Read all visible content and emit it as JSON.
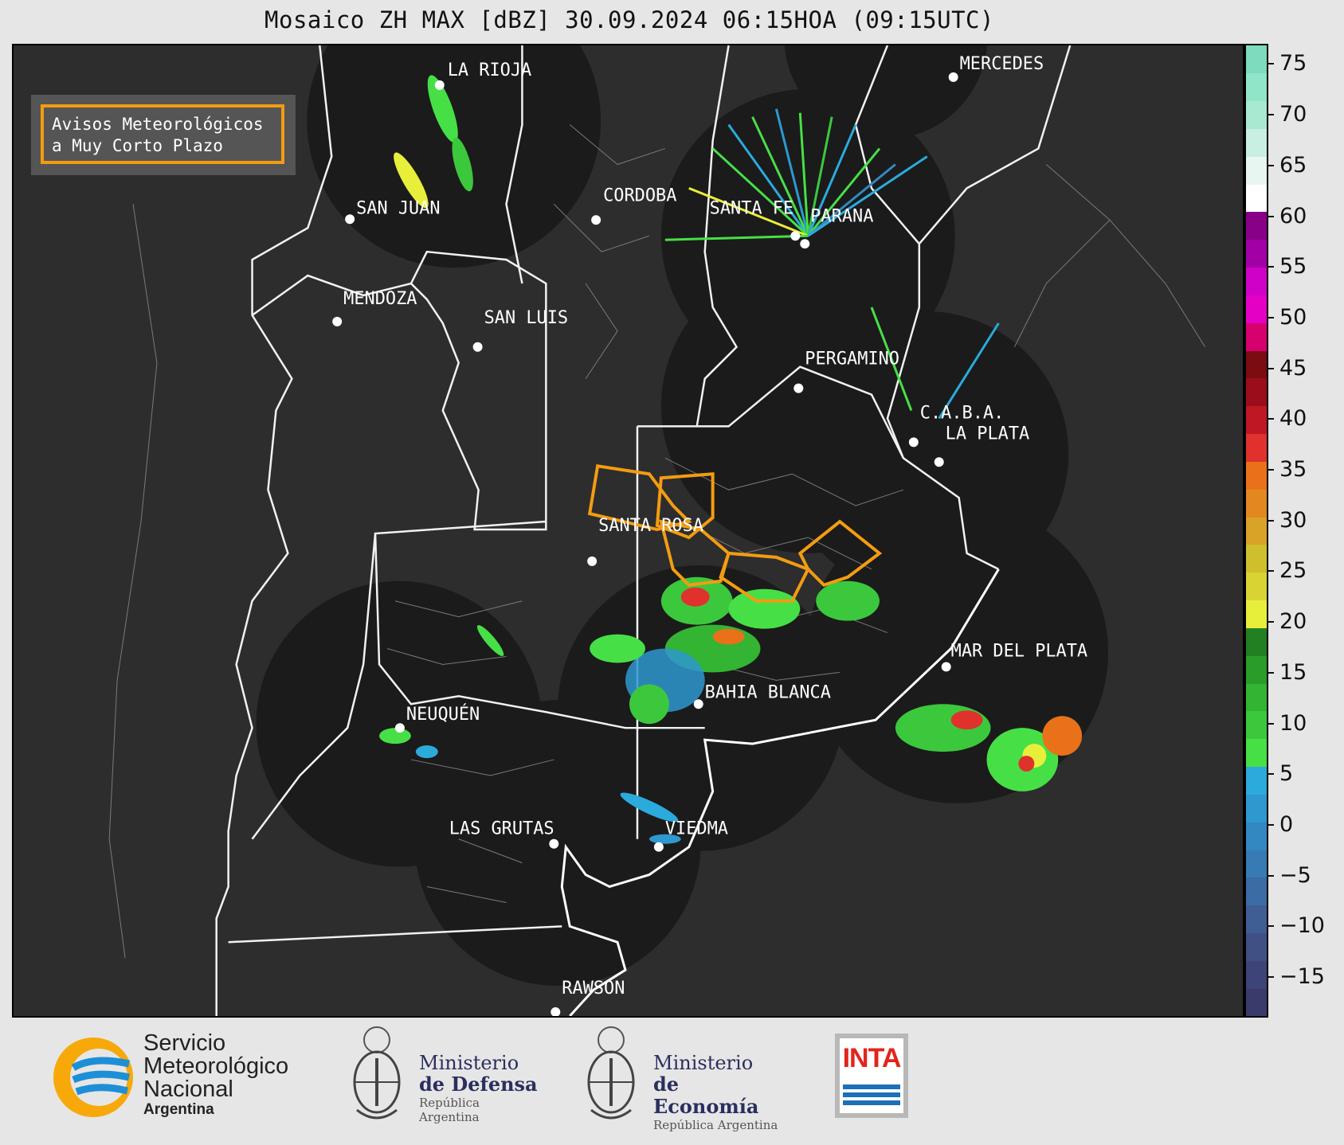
{
  "title": "Mosaico ZH MAX [dBZ] 30.09.2024 06:15HOA (09:15UTC)",
  "legend": {
    "line1": "Avisos Meteorológicos",
    "line2": "a Muy Corto Plazo",
    "border_color": "#f39c12"
  },
  "cities": [
    {
      "name": "LA RIOJA"
    },
    {
      "name": "MERCEDES"
    },
    {
      "name": "SAN JUAN"
    },
    {
      "name": "CORDOBA"
    },
    {
      "name": "SANTA FE"
    },
    {
      "name": "PARANA"
    },
    {
      "name": "MENDOZA"
    },
    {
      "name": "SAN LUIS"
    },
    {
      "name": "PERGAMINO"
    },
    {
      "name": "C.A.B.A."
    },
    {
      "name": "LA PLATA"
    },
    {
      "name": "SANTA ROSA"
    },
    {
      "name": "MAR DEL PLATA"
    },
    {
      "name": "NEUQUÉN"
    },
    {
      "name": "BAHIA BLANCA"
    },
    {
      "name": "LAS GRUTAS"
    },
    {
      "name": "VIEDMA"
    },
    {
      "name": "RAWSON"
    }
  ],
  "colorbar": {
    "ticks": [
      "75",
      "70",
      "65",
      "60",
      "55",
      "50",
      "45",
      "40",
      "35",
      "30",
      "25",
      "20",
      "15",
      "10",
      "5",
      "0",
      "−5",
      "−10",
      "−15"
    ],
    "min": -19,
    "max": 77,
    "colors": [
      "#3a3b6b",
      "#3d4478",
      "#405085",
      "#3f5e94",
      "#3c6ca4",
      "#387bb4",
      "#3388c2",
      "#2e98cf",
      "#2aabdc",
      "#46e046",
      "#3cc83c",
      "#33b433",
      "#2a9c2a",
      "#227f22",
      "#e8ef3a",
      "#d9d433",
      "#cfbf2d",
      "#d8a326",
      "#e3881e",
      "#e8711a",
      "#e0312c",
      "#c01724",
      "#9b0d1a",
      "#7a0c12",
      "#d6006f",
      "#e500c6",
      "#cf00c8",
      "#a200a6",
      "#880088",
      "#ffffff",
      "#e8f6f1",
      "#c8efe1",
      "#a9e8d1",
      "#90e4c7",
      "#7edbbd"
    ]
  },
  "footer": {
    "smn_line1": "Servicio",
    "smn_line2": "Meteorológico",
    "smn_line3": "Nacional",
    "smn_line4": "Argentina",
    "defensa_line1": "Ministerio",
    "defensa_line2": "de Defensa",
    "defensa_line3": "República Argentina",
    "economia_line1": "Ministerio",
    "economia_line2": "de Economía",
    "economia_line3": "República Argentina",
    "inta": "INTA"
  }
}
